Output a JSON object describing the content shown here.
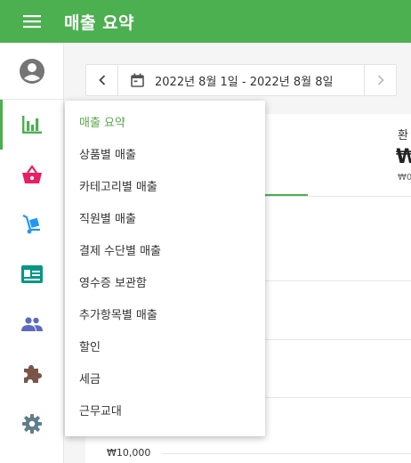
{
  "app": {
    "title": "매출 요약"
  },
  "colors": {
    "primary": "#4caf50",
    "basket": "#e91e63",
    "dolly": "#2196f3",
    "id_card": "#009688",
    "people": "#5c6bc0",
    "puzzle": "#795548",
    "gear": "#607d8b",
    "avatar": "#757575"
  },
  "rail": {
    "items": [
      {
        "id": "account",
        "icon": "account-circle-icon"
      },
      {
        "id": "reports",
        "icon": "bar-chart-icon",
        "active": true
      },
      {
        "id": "items",
        "icon": "basket-icon"
      },
      {
        "id": "inventory",
        "icon": "hand-truck-icon"
      },
      {
        "id": "employees",
        "icon": "id-card-icon"
      },
      {
        "id": "customers",
        "icon": "people-icon"
      },
      {
        "id": "integrations",
        "icon": "puzzle-icon"
      },
      {
        "id": "settings",
        "icon": "gear-icon"
      }
    ]
  },
  "datebar": {
    "range": "2022년 8월 1일 - 2022년 8월 8일"
  },
  "summary": {
    "label": "환",
    "value": "₩",
    "sub": "₩0"
  },
  "chart": {
    "y_tick": "₩10,000"
  },
  "menu": {
    "items": [
      {
        "label": "매출 요약",
        "selected": true
      },
      {
        "label": "상품별 매출"
      },
      {
        "label": "카테고리별 매출"
      },
      {
        "label": "직원별 매출"
      },
      {
        "label": "결제 수단별 매출"
      },
      {
        "label": "영수증 보관함"
      },
      {
        "label": "추가항목별 매출"
      },
      {
        "label": "할인"
      },
      {
        "label": "세금"
      },
      {
        "label": "근무교대"
      }
    ]
  }
}
